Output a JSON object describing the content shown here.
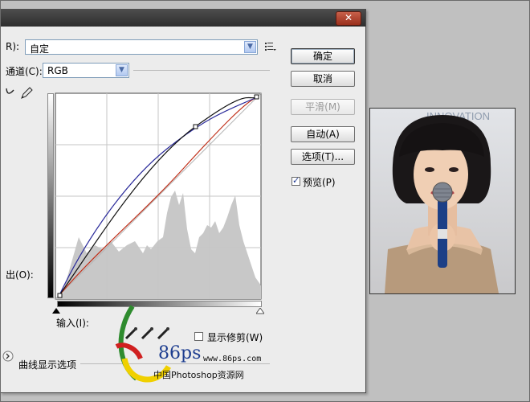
{
  "dialog": {
    "close_glyph": "✕",
    "preset": {
      "label_tail": "R):",
      "value": "自定"
    },
    "channel": {
      "label": "通道(C):",
      "value": "RGB"
    },
    "output_label": "出(O):",
    "input_label": "输入(I):",
    "show_clipping_label": "显示修剪(W)",
    "show_clipping_checked": false,
    "curve_options_label": "曲线显示选项",
    "buttons": {
      "ok": "确定",
      "cancel": "取消",
      "smooth": "平滑(M)",
      "auto": "自动(A)",
      "options": "选项(T)..."
    },
    "preview_label": "预览(P)",
    "preview_checked": true
  },
  "watermark": {
    "brand": "86ps",
    "url": "www.86ps.com",
    "site_name": "中国Photoshop资源网"
  },
  "colors": {
    "curve_black": "#111111",
    "curve_blue": "#2a2a9a",
    "curve_red": "#c0301a",
    "histogram": "#c8c8c8"
  },
  "photo": {
    "banner_text": "INNOVATION"
  }
}
